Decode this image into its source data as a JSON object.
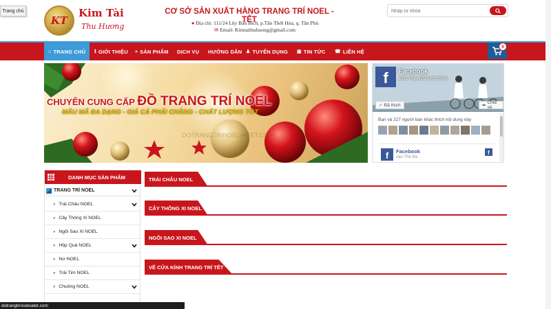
{
  "tooltip": "Trang chủ",
  "header": {
    "logo_mono": "KT",
    "brand_name": "Kim Tài",
    "brand_sub": "Thu Hương",
    "site_title": "CƠ SỞ SẢN XUẤT HÀNG TRANG TRÍ NOEL - TẾT",
    "address": "Địa chỉ: 111/24 Lũy Bán Bích, p.Tân Thới Hòa, q. Tân Phú",
    "email": "Email: Kimtaithuhuong@gmail.com"
  },
  "search": {
    "placeholder": "Nhập từ khóa",
    "icon": "search-icon"
  },
  "nav": {
    "items": [
      {
        "label": "TRANG CHỦ",
        "icon": "home-icon"
      },
      {
        "label": "GIỚI THIỆU",
        "icon": "info-icon"
      },
      {
        "label": "SẢN PHẨM",
        "icon": "gift-icon"
      },
      {
        "label": "DỊCH VỤ",
        "icon": ""
      },
      {
        "label": "HƯỚNG DẪN",
        "icon": ""
      },
      {
        "label": "TUYỂN DỤNG",
        "icon": "users-icon"
      },
      {
        "label": "TIN TỨC",
        "icon": "newspaper-icon"
      },
      {
        "label": "LIÊN HỆ",
        "icon": "phone-icon"
      }
    ],
    "cart_count": "0"
  },
  "banner": {
    "title_part1": "CHUYÊN CUNG CẤP",
    "title_part2": "ĐỒ TRANG TRÍ NOEL",
    "subtitle": "MẪU MÃ ĐA DẠNG - GIÁ CẢ PHẢI CHĂNG - CHẤT LƯỢNG TỐT",
    "watermark": "DOTRANGTRINOELVATET.COM"
  },
  "facebook": {
    "page_name": "Facebook",
    "likes": "206.742.420 lượt thích",
    "like_button": "Đã thích",
    "share_button": "Chia sẻ",
    "friends_text": "Bạn và 227 người bạn khác thích nội dung này",
    "post_name": "Facebook",
    "post_time": "vào Thứ Ba"
  },
  "sidebar": {
    "header": "DANH MỤC SẢN PHẨM",
    "category": "TRANG TRÍ NOEL",
    "items": [
      {
        "label": "Trái Châu NOEL",
        "has_children": true
      },
      {
        "label": "Cây Thông Xi NOEL",
        "has_children": false
      },
      {
        "label": "Ngôi Sao Xi NOEL",
        "has_children": false
      },
      {
        "label": "Hộp Quà NOEL",
        "has_children": true
      },
      {
        "label": "Nơ NOEL",
        "has_children": false
      },
      {
        "label": "Trái Tim NOEL",
        "has_children": false
      },
      {
        "label": "Chuông NOEL",
        "has_children": true
      }
    ]
  },
  "sections": [
    {
      "title": "TRÁI CHÂU NOEL"
    },
    {
      "title": "CÂY THÔNG XI NOEL"
    },
    {
      "title": "NGÔI SAO XI NOEL"
    },
    {
      "title": "VẼ CỬA KÍNH TRANG TRÍ TẾT"
    }
  ],
  "status_url": "dotrangtrinoelvatet.com",
  "colors": {
    "brand_red": "#c8161d",
    "nav_blue": "#3e9bd8",
    "fb_blue": "#3b5998"
  }
}
